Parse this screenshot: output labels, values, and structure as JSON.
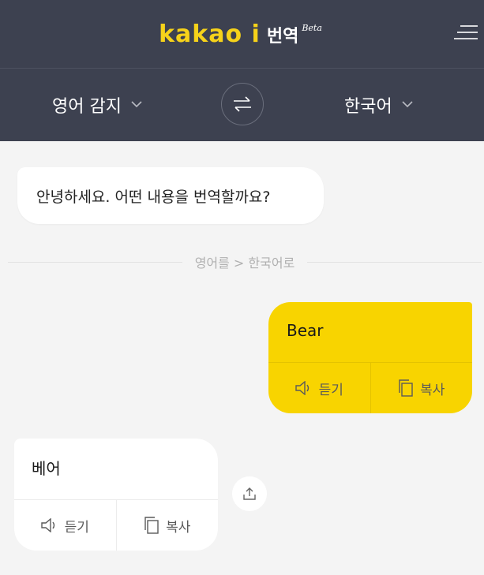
{
  "header": {
    "logo": "kakao i",
    "title": "번역",
    "beta": "Beta",
    "menu_icon": "hamburger-icon"
  },
  "langbar": {
    "source": "영어 감지",
    "target": "한국어",
    "chevron_icon": "chevron-down-icon",
    "swap_icon": "swap-arrows-icon"
  },
  "chat": {
    "greeting": "안녕하세요. 어떤 내용을 번역할까요?",
    "direction": "영어를 > 한국어로",
    "user_message": {
      "text": "Bear",
      "listen_label": "듣기",
      "copy_label": "복사"
    },
    "translation": {
      "text": "베어",
      "listen_label": "듣기",
      "copy_label": "복사"
    },
    "share_icon": "share-icon"
  },
  "colors": {
    "header_bg": "#3d4150",
    "brand_yellow": "#f6d21a",
    "user_bubble": "#f8d400",
    "background": "#f4f4f4"
  }
}
